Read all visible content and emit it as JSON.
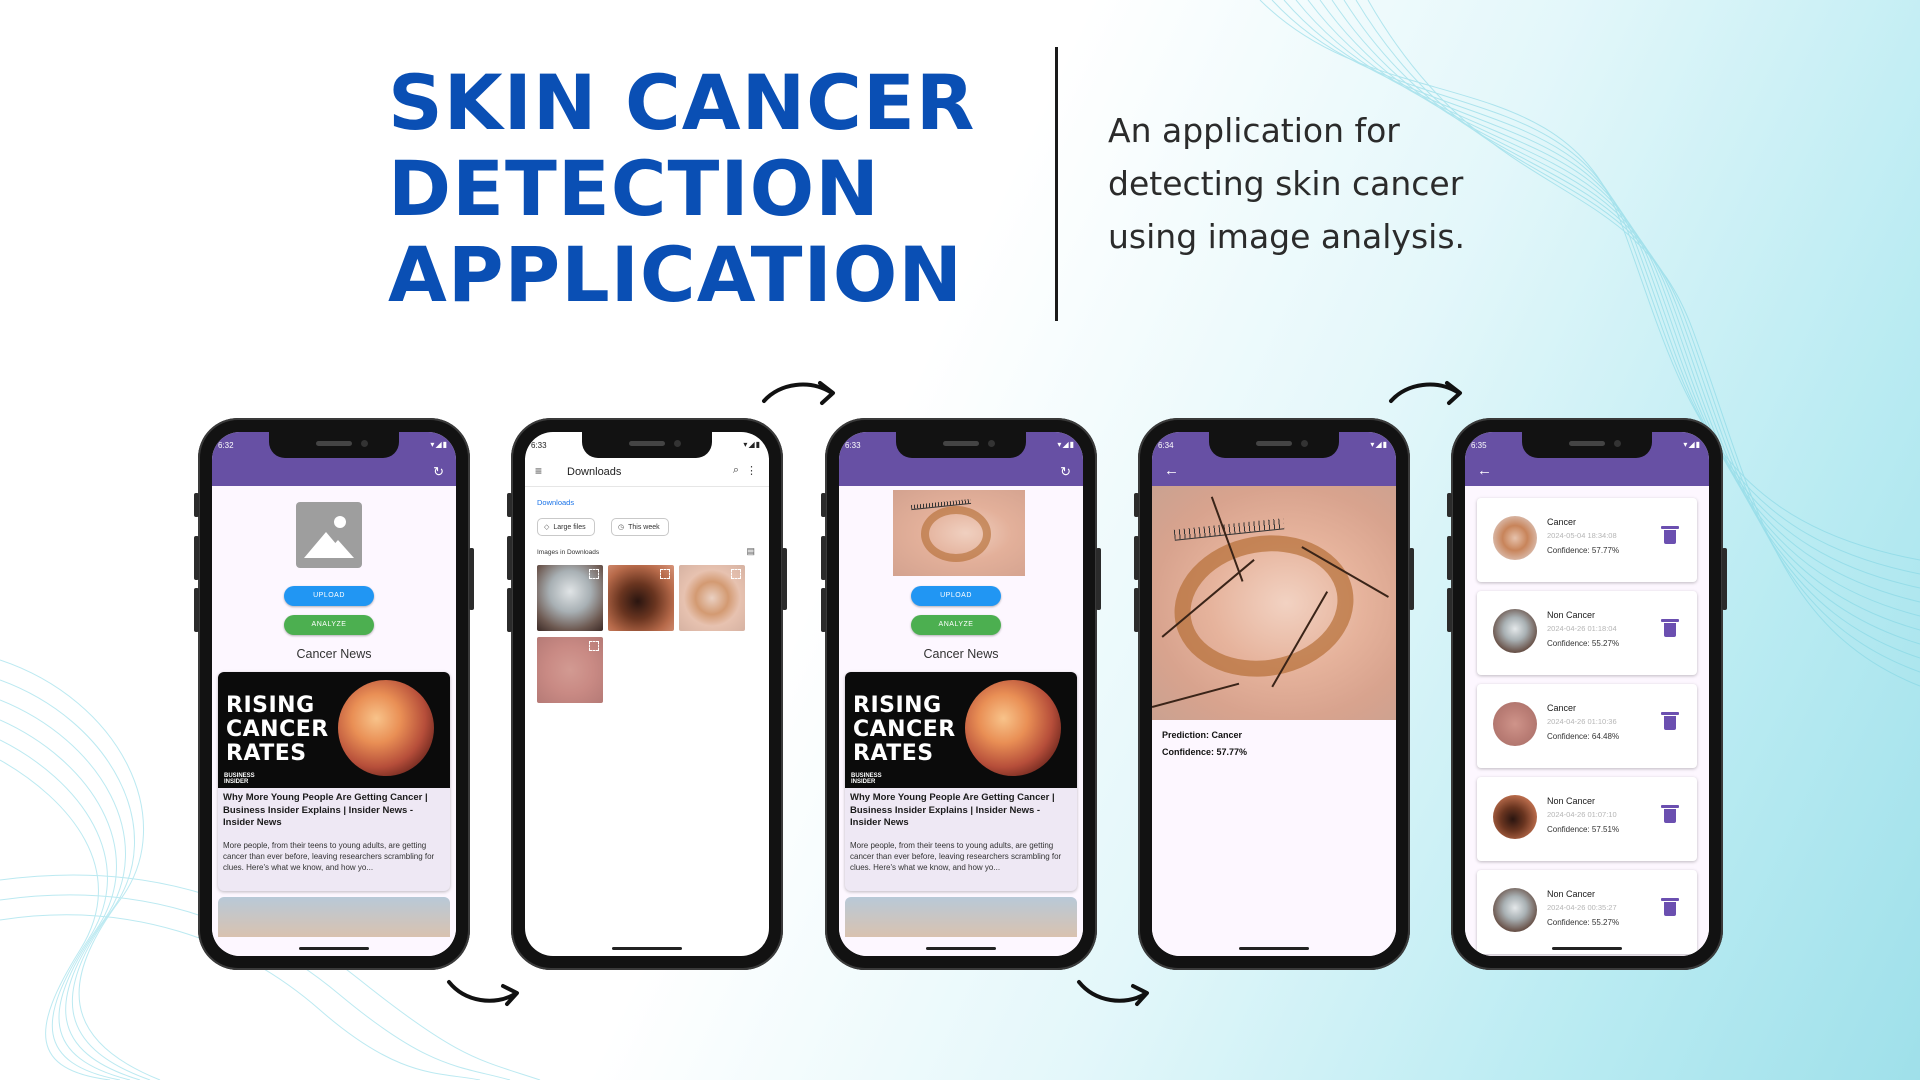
{
  "header": {
    "title_lines": [
      "SKIN CANCER",
      "DETECTION",
      "APPLICATION"
    ],
    "subtitle_lines": [
      "An application for",
      "detecting skin cancer",
      "using image analysis."
    ]
  },
  "phones": {
    "home": {
      "time": "6:32",
      "upload_label": "UPLOAD",
      "analyze_label": "ANALYZE",
      "news_heading": "Cancer News",
      "news_image_text": [
        "RISING",
        "CANCER",
        "RATES"
      ],
      "news_image_brand": [
        "BUSINESS",
        "INSIDER"
      ],
      "news_title": "Why More Young People Are Getting Cancer | Business Insider Explains | Insider News - Insider News",
      "news_desc": "More people, from their teens to young adults, are getting cancer than ever before, leaving researchers scrambling for clues. Here's what we know, and how yo..."
    },
    "picker": {
      "time": "6:33",
      "title": "Downloads",
      "breadcrumb": "Downloads",
      "chip_large": "Large files",
      "chip_week": "This week",
      "section": "Images in Downloads"
    },
    "analysis": {
      "time": "6:33",
      "upload_label": "UPLOAD",
      "analyze_label": "ANALYZE",
      "news_heading": "Cancer News",
      "news_image_text": [
        "RISING",
        "CANCER",
        "RATES"
      ],
      "news_image_brand": [
        "BUSINESS",
        "INSIDER"
      ],
      "news_title": "Why More Young People Are Getting Cancer | Business Insider Explains | Insider News - Insider News",
      "news_desc": "More people, from their teens to young adults, are getting cancer than ever before, leaving researchers scrambling for clues. Here's what we know, and how yo..."
    },
    "result": {
      "time": "6:34",
      "prediction": "Prediction: Cancer",
      "confidence": "Confidence: 57.77%"
    },
    "history": {
      "time": "6:35",
      "items": [
        {
          "label": "Cancer",
          "date": "2024-05-04 18:34:08",
          "confidence": "Confidence: 57.77%",
          "tone": "lesion"
        },
        {
          "label": "Non Cancer",
          "date": "2024-04-26 01:18:04",
          "confidence": "Confidence: 55.27%",
          "tone": "pearl"
        },
        {
          "label": "Cancer",
          "date": "2024-04-26 01:10:36",
          "confidence": "Confidence: 64.48%",
          "tone": "pink"
        },
        {
          "label": "Non Cancer",
          "date": "2024-04-26 01:07:10",
          "confidence": "Confidence: 57.51%",
          "tone": "dark"
        },
        {
          "label": "Non Cancer",
          "date": "2024-04-26 00:35:27",
          "confidence": "Confidence: 55.27%",
          "tone": "pearl"
        }
      ]
    }
  },
  "icons": {
    "status": "signal-wifi-battery-icons",
    "history": "history-icon",
    "back": "back-arrow-icon",
    "delete": "trash-icon",
    "menu": "hamburger-menu-icon",
    "search": "search-icon",
    "more": "more-vert-icon"
  },
  "colors": {
    "title": "#0a4fb4",
    "appbar": "#6750a4",
    "upload": "#2196f3",
    "analyze": "#4caf50",
    "trash": "#6b4fb0",
    "link": "#1a73e8"
  }
}
